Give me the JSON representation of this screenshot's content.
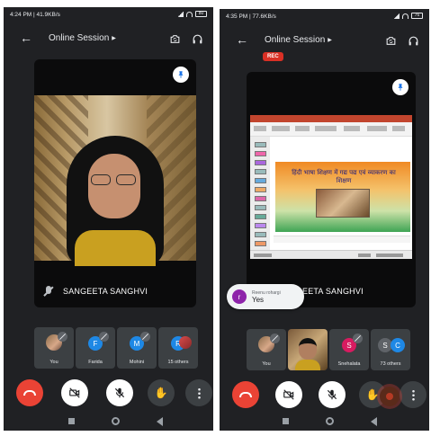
{
  "left": {
    "status": {
      "time": "4:24 PM | 41.9KB/s",
      "extra": "℧ ···",
      "battery": "80"
    },
    "header": {
      "title": "Online Session"
    },
    "main_tile": {
      "name": "SANGEETA SANGHVI"
    },
    "participants": [
      {
        "initial": "",
        "label": "You",
        "color": "#6d4c41"
      },
      {
        "initial": "F",
        "label": "Farida",
        "color": "#1e88e5"
      },
      {
        "initial": "M",
        "label": "Mohini",
        "color": "#1e88e5"
      },
      {
        "initial": "R",
        "label": "15 others",
        "color": "#1e88e5"
      }
    ]
  },
  "right": {
    "status": {
      "time": "4:35 PM | 77.6KB/s",
      "extra": "℧ ···",
      "battery": "76"
    },
    "header": {
      "title": "Online Session",
      "rec": "REC"
    },
    "main_tile": {
      "name": "SANGHVI",
      "name_prefix": "EETA"
    },
    "slide": {
      "heading": "हिंदी भाषा शिक्षण में गद्य पद्य एवं व्याकरण का शिक्षण"
    },
    "chat": {
      "initial": "r",
      "sender": "Reenu rohargi",
      "message": "Yes"
    },
    "participants": [
      {
        "initial": "",
        "label": "You",
        "color": "#6d4c41"
      },
      {
        "initial": "",
        "label": "",
        "color": ""
      },
      {
        "initial": "S",
        "label": "Snehalata",
        "color": "#d81b60"
      },
      {
        "initial": "S",
        "initial2": "C",
        "label": "73 others",
        "color": "#5f6368",
        "color2": "#1e88e5"
      }
    ]
  }
}
